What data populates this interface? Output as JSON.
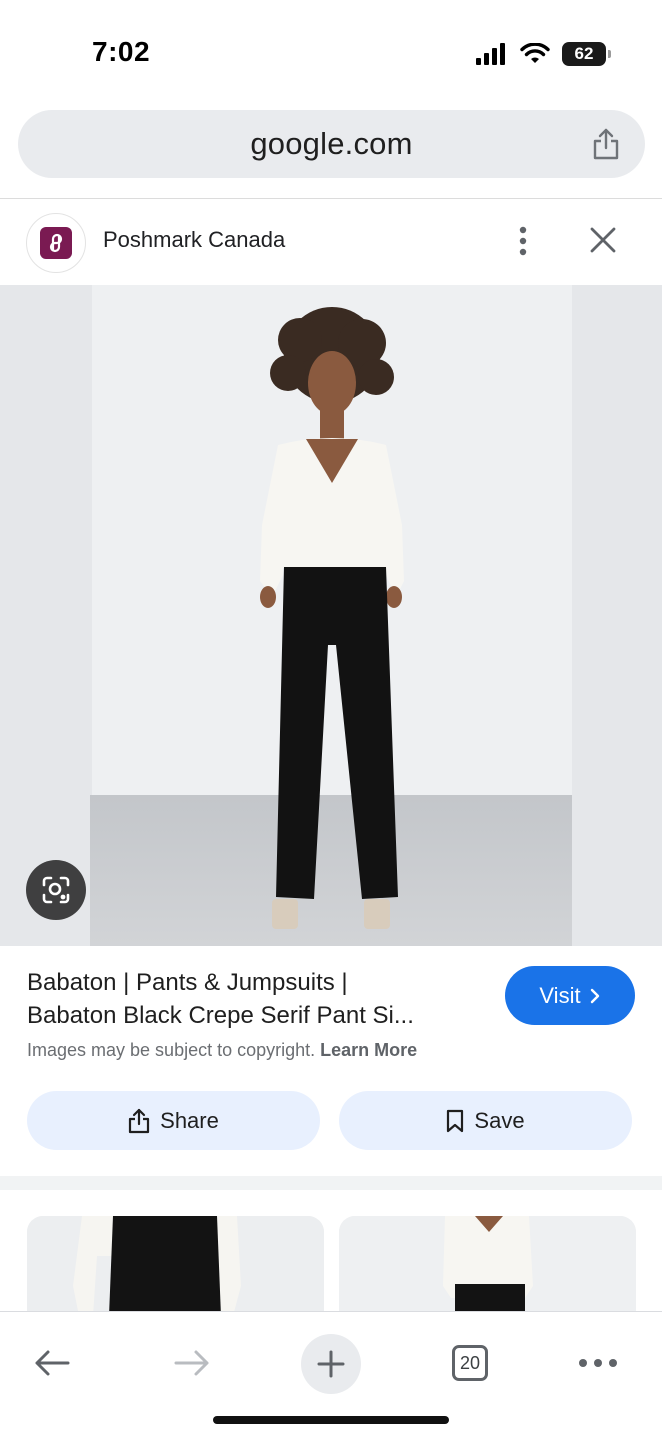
{
  "status_bar": {
    "time": "7:02",
    "battery": "62"
  },
  "address_bar": {
    "url": "google.com"
  },
  "source": {
    "name": "Poshmark Canada"
  },
  "result": {
    "title_line1": "Babaton | Pants & Jumpsuits |",
    "title_line2": "Babaton Black Crepe Serif Pant Si...",
    "copyright_text": "Images may be subject to copyright.",
    "learn_more": "Learn More",
    "visit_label": "Visit"
  },
  "actions": {
    "share_label": "Share",
    "save_label": "Save"
  },
  "toolbar": {
    "tab_count": "20"
  },
  "colors": {
    "accent": "#1a73e8",
    "pill_bg": "#e8f0fe",
    "favicon": "#7a1a52"
  },
  "icons": [
    "signal-icon",
    "wifi-icon",
    "battery-icon",
    "share-icon",
    "more-vert-icon",
    "close-icon",
    "lens-icon",
    "chevron-right-icon",
    "bookmark-icon",
    "back-arrow-icon",
    "forward-arrow-icon",
    "plus-icon",
    "tabs-icon",
    "more-horiz-icon"
  ]
}
